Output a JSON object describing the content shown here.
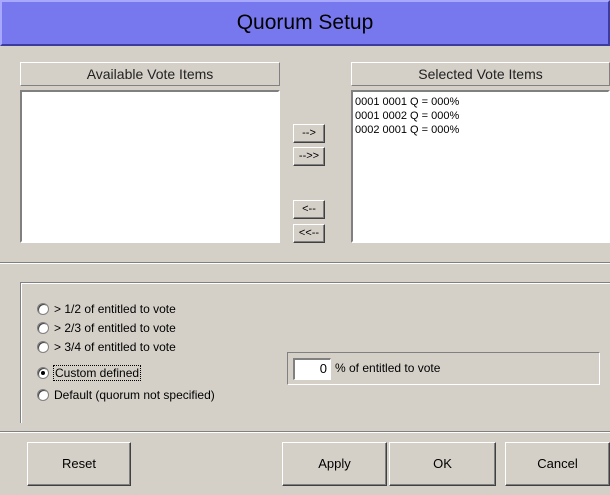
{
  "title": "Quorum Setup",
  "available": {
    "header": "Available Vote Items",
    "items": []
  },
  "selected": {
    "header": "Selected Vote Items",
    "items": [
      "0001 0001 Q = 000%",
      "0001 0002 Q = 000%",
      "0002 0001 Q = 000%"
    ]
  },
  "arrows": {
    "add": "-->",
    "add_all": "-->>",
    "remove": "<--",
    "remove_all": "<<--"
  },
  "options": [
    {
      "label": "> 1/2 of entitled to vote",
      "checked": false
    },
    {
      "label": "> 2/3 of entitled to vote",
      "checked": false
    },
    {
      "label": "> 3/4 of entitled to vote",
      "checked": false
    },
    {
      "label": "Custom defined",
      "checked": true
    },
    {
      "label": "Default (quorum not specified)",
      "checked": false
    }
  ],
  "custom": {
    "value": "0",
    "suffix": "% of entitled to vote"
  },
  "buttons": {
    "reset": "Reset",
    "apply": "Apply",
    "ok": "OK",
    "cancel": "Cancel"
  }
}
